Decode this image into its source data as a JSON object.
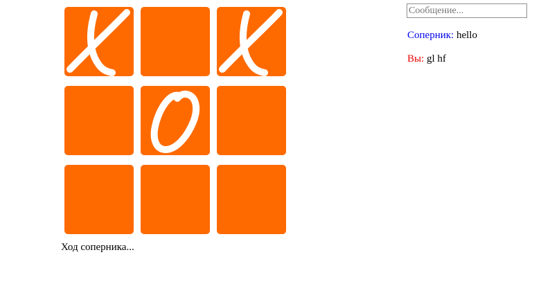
{
  "colors": {
    "cell": "#fe6a00",
    "mark": "#ffffff",
    "opponent_label": "#0000ee",
    "self_label": "#ee0000"
  },
  "board": {
    "cells": [
      {
        "mark": "X"
      },
      {
        "mark": ""
      },
      {
        "mark": "X"
      },
      {
        "mark": ""
      },
      {
        "mark": "O"
      },
      {
        "mark": ""
      },
      {
        "mark": ""
      },
      {
        "mark": ""
      },
      {
        "mark": ""
      }
    ]
  },
  "status": "Ход соперника...",
  "chat": {
    "placeholder": "Сообщение...",
    "value": "",
    "messages": [
      {
        "author": "Соперник:",
        "author_color": "#0000ee",
        "text": "hello"
      },
      {
        "author": "Вы:",
        "author_color": "#ee0000",
        "text": "gl hf"
      }
    ]
  }
}
